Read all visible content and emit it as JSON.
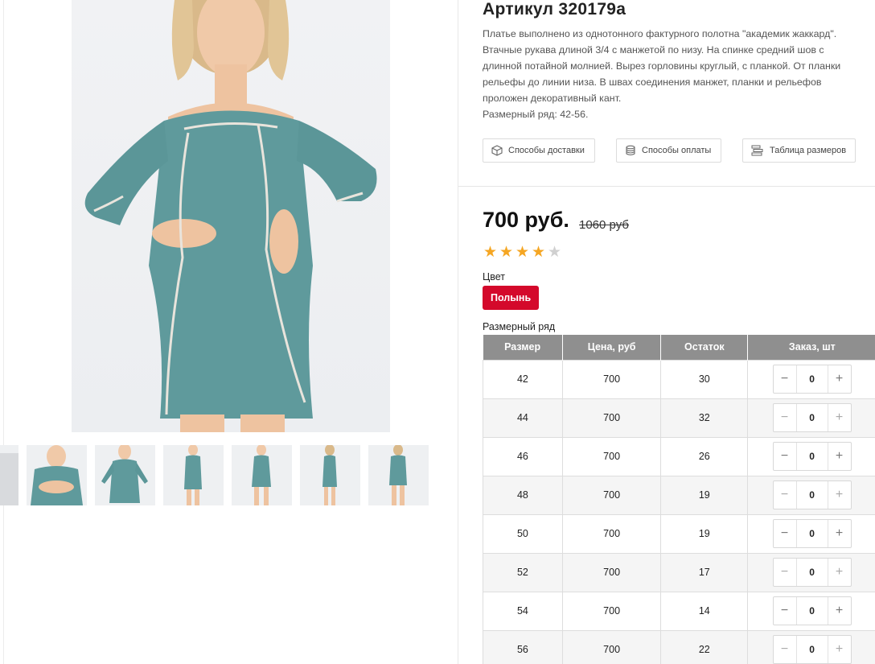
{
  "product": {
    "title": "Артикул 320179а",
    "description_lines": [
      "Платье выполнено из однотонного фактурного полотна \"академик жаккард\".",
      "Втачные рукава длиной 3/4 с манжетой по низу. На спинке средний шов с",
      "длинной потайной молнией. Вырез горловины круглый, с планкой. От планки",
      "рельефы до линии низа. В швах соединения манжет, планки и рельефов",
      "проложен декоративный кант.",
      "Размерный ряд: 42-56."
    ]
  },
  "info_buttons": {
    "delivery": "Способы доставки",
    "payment": "Способы оплаты",
    "size_table": "Таблица размеров"
  },
  "price": {
    "current": "700 руб.",
    "old": "1060 руб"
  },
  "rating": {
    "value": 4,
    "max": 5
  },
  "color": {
    "label": "Цвет",
    "selected": "Полынь",
    "chip_color": "#d4092b"
  },
  "sizes": {
    "label": "Размерный ряд",
    "headers": [
      "Размер",
      "Цена, руб",
      "Остаток",
      "Заказ, шт"
    ],
    "rows": [
      {
        "size": "42",
        "price": "700",
        "stock": "30",
        "qty": "0"
      },
      {
        "size": "44",
        "price": "700",
        "stock": "32",
        "qty": "0"
      },
      {
        "size": "46",
        "price": "700",
        "stock": "26",
        "qty": "0"
      },
      {
        "size": "48",
        "price": "700",
        "stock": "19",
        "qty": "0"
      },
      {
        "size": "50",
        "price": "700",
        "stock": "19",
        "qty": "0"
      },
      {
        "size": "52",
        "price": "700",
        "stock": "17",
        "qty": "0"
      },
      {
        "size": "54",
        "price": "700",
        "stock": "14",
        "qty": "0"
      },
      {
        "size": "56",
        "price": "700",
        "stock": "22",
        "qty": "0"
      }
    ],
    "minus_symbol": "−",
    "plus_symbol": "+"
  },
  "gallery": {
    "dress_color": "#5f9a9c",
    "thumbnail_count": 7
  }
}
